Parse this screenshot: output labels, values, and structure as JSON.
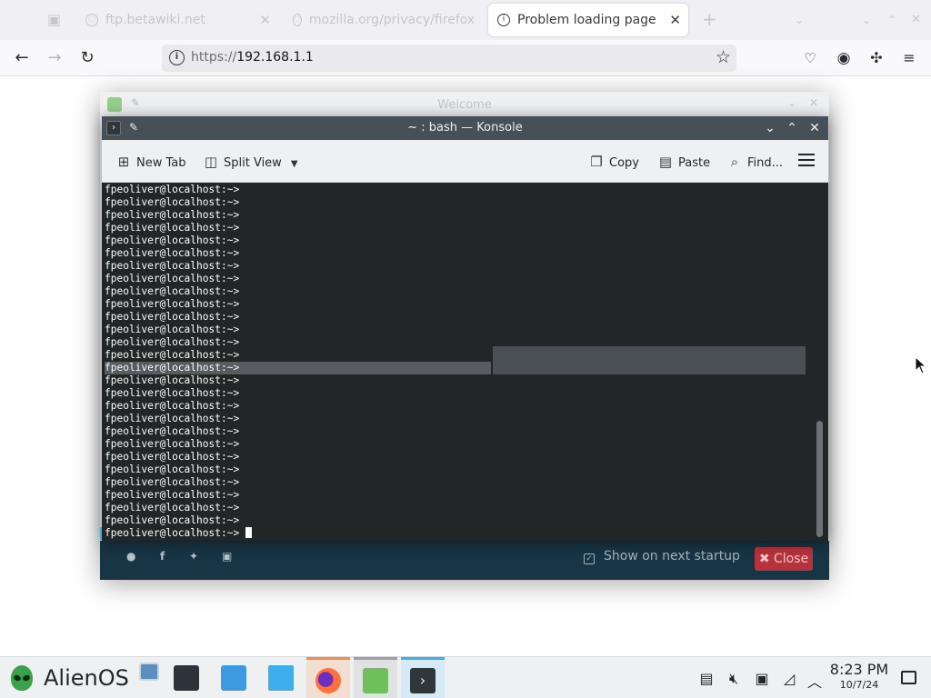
{
  "browser": {
    "tabs": [
      {
        "label": "ftp.betawiki.net",
        "active": false
      },
      {
        "label": "mozilla.org/privacy/firefox",
        "active": false
      },
      {
        "label": "Problem loading page",
        "active": true
      }
    ],
    "new_tab_glyph": "+",
    "url_scheme": "https://",
    "url_host": "192.168.1.1"
  },
  "welcome": {
    "title": "Welcome",
    "show_on_startup_label": "Show on next startup",
    "close_label": "Close"
  },
  "konsole": {
    "title": "~ : bash — Konsole",
    "toolbar": {
      "new_tab": "New Tab",
      "split_view": "Split View",
      "copy": "Copy",
      "paste": "Paste",
      "find": "Find..."
    },
    "prompt": "fpeoliver@localhost:~>",
    "line_count": 28,
    "selected_line_index": 14
  },
  "taskbar": {
    "launcher_label": "AlienOS",
    "clock_time": "8:23 PM",
    "clock_date": "10/7/24"
  },
  "colors": {
    "konsole_bg": "#232627",
    "konsole_title": "#475057",
    "accent": "#3daee9",
    "welcome_footer": "#173545",
    "close_button": "#b8323c"
  }
}
